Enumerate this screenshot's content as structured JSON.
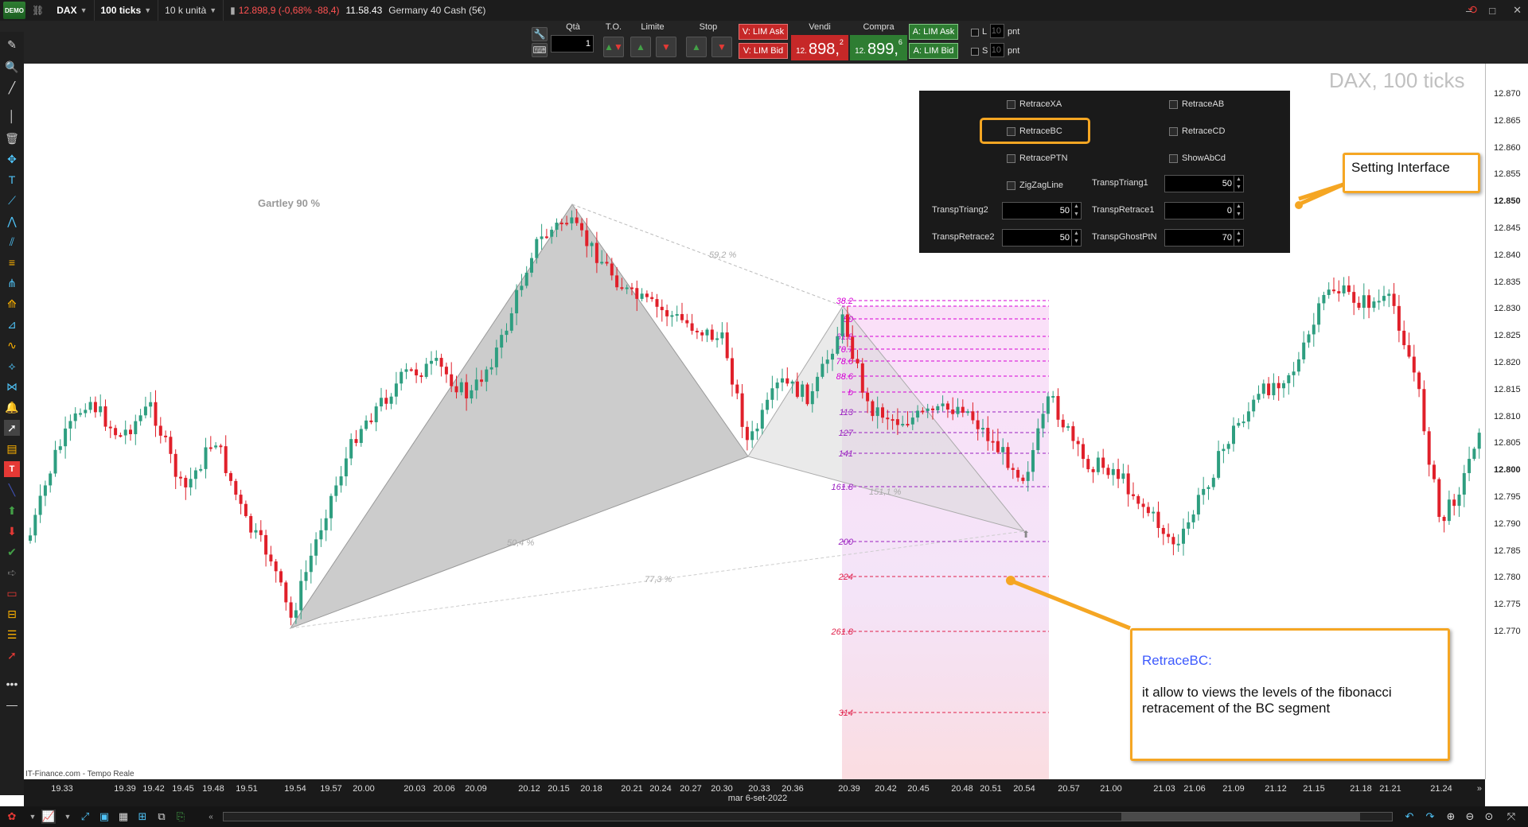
{
  "topbar": {
    "logo": "DEMO",
    "symbol": "DAX",
    "interval": "100 ticks",
    "unit": "10 k unità",
    "quote": "12.898,9 (-0,68% -88,4)",
    "time": "11.58.43",
    "instrument": "Germany 40 Cash (5€)"
  },
  "orderbar": {
    "qty_label": "Qtà",
    "qty_value": "1",
    "to_label": "T.O.",
    "limit_label": "Limite",
    "stop_label": "Stop",
    "v_lim_ask": "V: LIM Ask",
    "v_lim_bid": "V: LIM Bid",
    "sell_label": "Vendi",
    "sell_prefix": "12.",
    "sell_big": "898,",
    "sell_sup": "2",
    "buy_label": "Compra",
    "buy_prefix": "12.",
    "buy_big": "899,",
    "buy_sup": "6",
    "a_lim_ask": "A: LIM Ask",
    "a_lim_bid": "A: LIM Bid",
    "l_label": "L",
    "s_label": "S",
    "l_value": "10",
    "s_value": "10",
    "pnt1": "pnt",
    "pnt2": "pnt"
  },
  "settings": {
    "retrace_xa": "RetraceXA",
    "retrace_ab": "RetraceAB",
    "retrace_bc": "RetraceBC",
    "retrace_cd": "RetraceCD",
    "retrace_ptn": "RetracePTN",
    "show_abcd": "ShowAbCd",
    "zigzag_line": "ZigZagLine",
    "transp_triang1_label": "TranspTriang1",
    "transp_triang1_value": "50",
    "transp_triang2_label": "TranspTriang2",
    "transp_triang2_value": "50",
    "transp_retrace1_label": "TranspRetrace1",
    "transp_retrace1_value": "0",
    "transp_retrace2_label": "TranspRetrace2",
    "transp_retrace2_value": "50",
    "transp_ghost_label": "TranspGhostPtN",
    "transp_ghost_value": "70"
  },
  "chart": {
    "watermark": "DAX, 100 ticks",
    "pattern_label": "Gartley 90 %",
    "source": "IT-Finance.com - Tempo Reale",
    "ratio_labels": [
      "59,2 %",
      "50,4 %",
      "77,3 %",
      "151,1 %"
    ],
    "fib_levels": [
      "38.2",
      "50",
      "61.8",
      "70.7",
      "78.6",
      "88.6",
      "b",
      "113",
      "127",
      "141",
      "161.8",
      "200",
      "224",
      "261.8",
      "314"
    ],
    "price_labels": [
      "12.870",
      "12.865",
      "12.860",
      "12.855",
      "12.850",
      "12.845",
      "12.840",
      "12.835",
      "12.830",
      "12.825",
      "12.820",
      "12.815",
      "12.810",
      "12.805",
      "12.800",
      "12.795",
      "12.790",
      "12.785",
      "12.780",
      "12.775",
      "12.770"
    ],
    "time_labels": [
      "19.33",
      "19.39",
      "19.42",
      "19.45",
      "19.48",
      "19.51",
      "19.54",
      "19.57",
      "20.00",
      "20.03",
      "20.06",
      "20.09",
      "20.12",
      "20.15",
      "20.18",
      "20.21",
      "20.24",
      "20.27",
      "20.30",
      "20.33",
      "20.36",
      "20.39",
      "20.42",
      "20.45",
      "20.48",
      "20.51",
      "20.54",
      "20.57",
      "21.00",
      "21.03",
      "21.06",
      "21.09",
      "21.12",
      "21.15",
      "21.18",
      "21.21",
      "21.24"
    ],
    "date_label": "mar 6-set-2022",
    "colors": {
      "up": "#2e9e80",
      "down": "#e0202a",
      "fib_magenta": "#d600d6",
      "fib_red": "#e0204a",
      "accent": "#f5a623",
      "callout_title": "#3d5afe"
    }
  },
  "callouts": {
    "setting_interface": "Setting Interface",
    "retrace_title": "RetraceBC:",
    "retrace_text": "it allow to views the levels of the fibonacci retracement of the BC segment"
  }
}
